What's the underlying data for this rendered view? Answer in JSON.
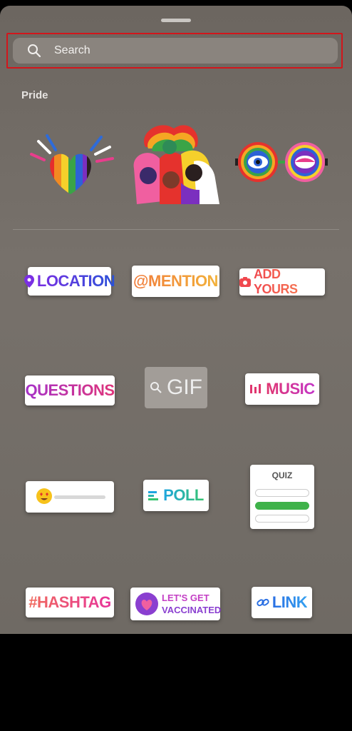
{
  "search": {
    "placeholder": "Search"
  },
  "section": {
    "title": "Pride"
  },
  "pride_stickers": [
    {
      "name": "pride-heart-sticker"
    },
    {
      "name": "pride-people-sticker"
    },
    {
      "name": "pride-eyes-sticker"
    }
  ],
  "stickers": {
    "location": "LOCATION",
    "mention": "@MENTION",
    "add_yours": "ADD YOURS",
    "questions": "QUESTIONS",
    "gif": "GIF",
    "music": "MUSIC",
    "poll": "POLL",
    "quiz": "QUIZ",
    "hashtag": "#HASHTAG",
    "vaccinated_line1": "LET'S GET",
    "vaccinated_line2": "VACCINATED",
    "link": "LINK"
  },
  "colors": {
    "panel": "#736d67",
    "search_highlight": "#d2161c",
    "poll_green": "#3fb24a"
  },
  "icons": [
    "search-icon",
    "location-pin-icon",
    "camera-icon",
    "music-bars-icon",
    "poll-lines-icon",
    "heart-emoji-icon",
    "link-icon",
    "gif-search-icon"
  ]
}
